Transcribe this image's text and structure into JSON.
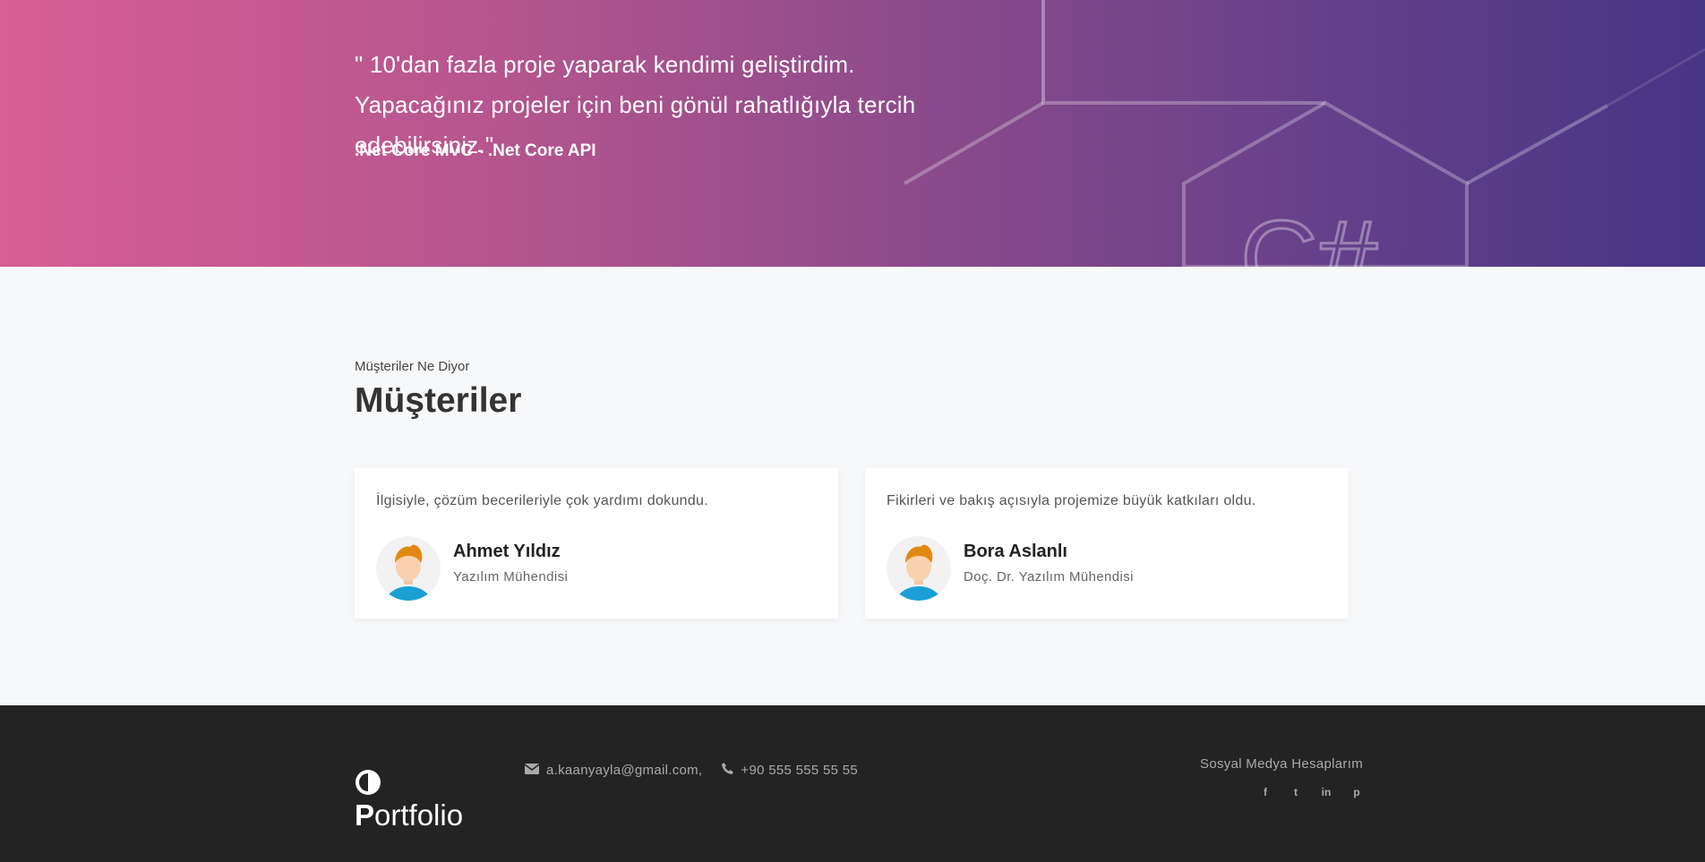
{
  "hero": {
    "quote": "\" 10'dan fazla proje yaparak kendimi geliştirdim. Yapacağınız projeler için beni gönül rahatlığıyla tercih edebilirsiniz.\"",
    "tech": ".Net Core MVC - .Net Core API",
    "bg_glyph": "C#"
  },
  "clients": {
    "eyebrow": "Müşteriler Ne Diyor",
    "heading": "Müşteriler",
    "items": [
      {
        "text": "İlgisiyle, çözüm becerileriyle çok yardımı dokundu.",
        "name": "Ahmet Yıldız",
        "role": "Yazılım Mühendisi",
        "avatar_icon": "user-avatar-icon"
      },
      {
        "text": "Fikirleri ve bakış açısıyla projemize büyük katkıları oldu.",
        "name": "Bora Aslanlı",
        "role": "Doç. Dr. Yazılım Mühendisi",
        "avatar_icon": "user-avatar-icon"
      }
    ]
  },
  "footer": {
    "logo_first": "P",
    "logo_rest": "ortfolio",
    "email": "a.kaanyayla@gmail.com,",
    "phone": "+90 555 555 55 55",
    "social_title": "Sosyal Medya Hesaplarım",
    "social": [
      {
        "icon": "facebook-icon",
        "glyph": "f"
      },
      {
        "icon": "twitter-icon",
        "glyph": "t"
      },
      {
        "icon": "linkedin-icon",
        "glyph": "in"
      },
      {
        "icon": "pinterest-icon",
        "glyph": "p"
      }
    ]
  },
  "colors": {
    "hero_start": "#d85e95",
    "hero_end": "#473585",
    "footer_bg": "#232323",
    "page_bg": "#f7f8fa"
  }
}
